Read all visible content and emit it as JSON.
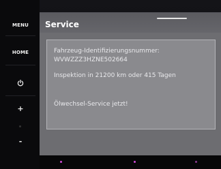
{
  "sidebar": {
    "menu_label": "MENU",
    "home_label": "HOME",
    "power_icon": "power-icon",
    "volume_up": "+",
    "volume_down": "-"
  },
  "header": {
    "title": "Service"
  },
  "service_info": {
    "vin_label": "Fahrzeug-Identifizierungsnummer:",
    "vin_value": "WVWZZZ3HZNE502664",
    "inspection": "Inspektion in 21200 km oder 415 Tagen",
    "oil_service": "Ölwechsel-Service jetzt!"
  },
  "colors": {
    "display_bg": "#6d6d71",
    "content_bg": "#8a8a8e",
    "led_magenta": "#d04ad8"
  }
}
